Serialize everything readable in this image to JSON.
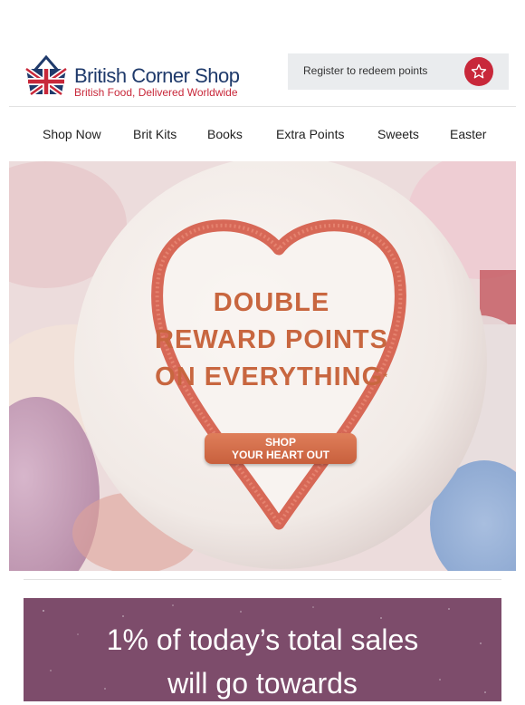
{
  "brand": {
    "name": "British Corner Shop",
    "tagline": "British Food, Delivered Worldwide",
    "logo_icon": "union-jack-basket-icon",
    "colors": {
      "navy": "#1f3a6b",
      "red": "#c8283a"
    }
  },
  "account": {
    "register_label": "Register to redeem points",
    "favorites_icon": "star-icon"
  },
  "nav": {
    "items": [
      {
        "label": "Shop Now"
      },
      {
        "label": "Brit Kits"
      },
      {
        "label": "Books"
      },
      {
        "label": "Extra Points"
      },
      {
        "label": "Sweets"
      },
      {
        "label": "Easter"
      }
    ]
  },
  "hero": {
    "headline_lines": [
      "DOUBLE",
      "REWARD POINTS",
      "ON EVERYTHING"
    ],
    "headline_mark": "*",
    "cta_lines": [
      "SHOP",
      "YOUR HEART OUT"
    ],
    "accent_color": "#c8663f"
  },
  "banner": {
    "lines": [
      "1% of today’s total sales",
      "will go towards"
    ],
    "background": "#7d4c6b"
  }
}
